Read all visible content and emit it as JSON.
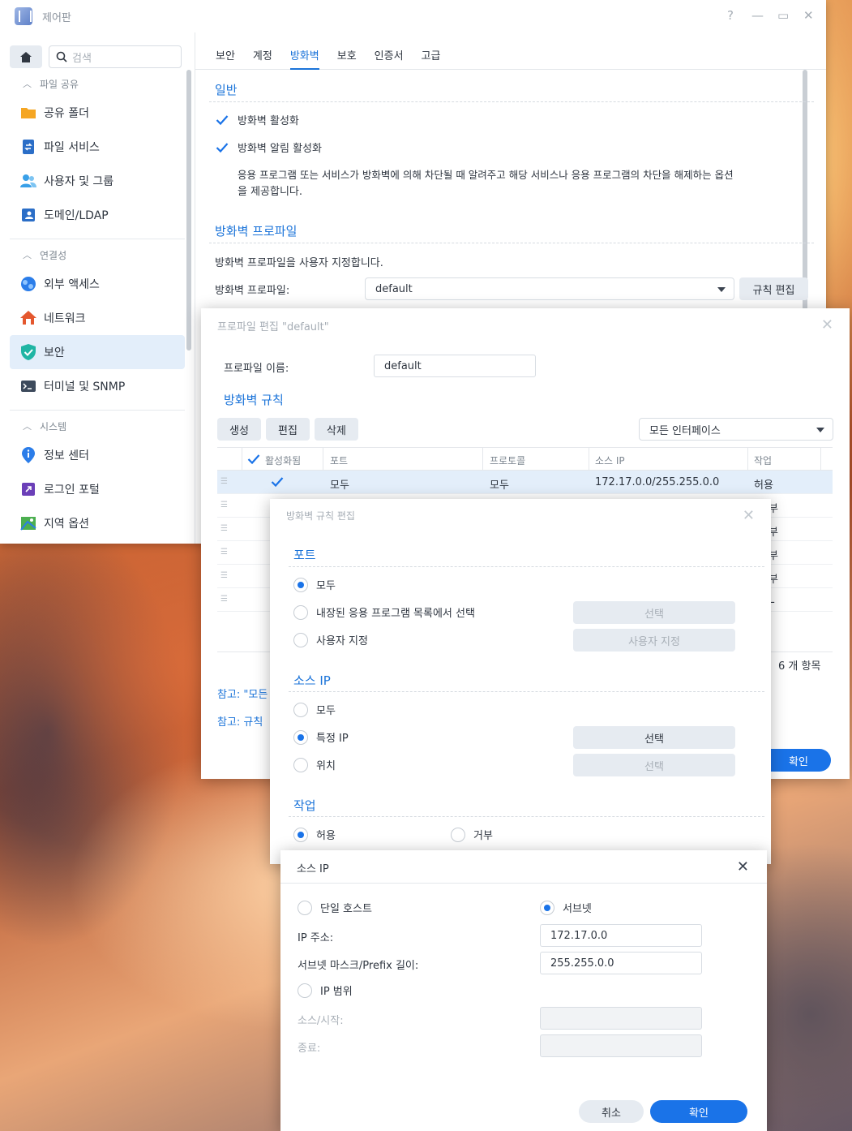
{
  "window": {
    "title": "제어판",
    "controls": [
      "?",
      "—",
      "▭",
      "✕"
    ]
  },
  "sidebar": {
    "search_placeholder": "검색",
    "sections": [
      {
        "label": "파일 공유",
        "items": [
          "공유 폴더",
          "파일 서비스",
          "사용자 및 그룹",
          "도메인/LDAP"
        ]
      },
      {
        "label": "연결성",
        "items": [
          "외부 액세스",
          "네트워크",
          "보안",
          "터미널 및 SNMP"
        ]
      },
      {
        "label": "시스템",
        "items": [
          "정보 센터",
          "로그인 포털",
          "지역 옵션"
        ]
      }
    ],
    "active_item": "보안"
  },
  "tabs": [
    "보안",
    "계정",
    "방화벽",
    "보호",
    "인증서",
    "고급"
  ],
  "firewall": {
    "general_title": "일반",
    "enable_firewall": "방화벽 활성화",
    "enable_notify": "방화벽 알림 활성화",
    "notify_desc_line1": "응용 프로그램 또는 서비스가 방화벽에 의해 차단될 때 알려주고 해당 서비스나 응용 프로그램의 차단을 해제하는 옵션",
    "notify_desc_line2": "을 제공합니다.",
    "profile_title": "방화벽 프로파일",
    "profile_desc": "방화벽 프로파일을 사용자 지정합니다.",
    "profile_label": "방화벽 프로파일:",
    "profile_value": "default",
    "edit_rules": "규칙 편집"
  },
  "profile_dialog": {
    "title": "프로파일 편집 \"default\"",
    "name_label": "프로파일 이름:",
    "name_value": "default",
    "rules_title": "방화벽 규칙",
    "btn_create": "생성",
    "btn_edit": "편집",
    "btn_delete": "삭제",
    "interface": "모든 인터페이스",
    "columns": [
      "활성화됨",
      "포트",
      "프로토콜",
      "소스 IP",
      "작업"
    ],
    "row": {
      "port": "모두",
      "protocol": "모두",
      "source": "172.17.0.0/255.255.0.0",
      "action": "허용"
    },
    "partial_actions": [
      "부",
      "부",
      "부",
      "부",
      "L"
    ],
    "count": "6 개 항목",
    "note1": "참고: \"모든",
    "note2": "참고: 규칙",
    "ok_partial": "확인"
  },
  "rule_dialog": {
    "title": "방화벽 규칙 편집",
    "port_title": "포트",
    "port_all": "모두",
    "port_builtin": "내장된 응용 프로그램 목록에서 선택",
    "port_custom": "사용자 지정",
    "btn_select": "선택",
    "btn_custom": "사용자 지정",
    "source_title": "소스 IP",
    "src_all": "모두",
    "src_specific": "특정 IP",
    "src_location": "위치",
    "action_title": "작업",
    "allow": "허용",
    "deny": "거부"
  },
  "source_dialog": {
    "title": "소스 IP",
    "single_host": "단일 호스트",
    "subnet": "서브넷",
    "ip_label": "IP 주소:",
    "ip_value": "172.17.0.0",
    "mask_label": "서브넷 마스크/Prefix 길이:",
    "mask_value": "255.255.0.0",
    "ip_range": "IP 범위",
    "start_label": "소스/시작:",
    "end_label": "종료:",
    "cancel": "취소",
    "ok": "확인"
  }
}
